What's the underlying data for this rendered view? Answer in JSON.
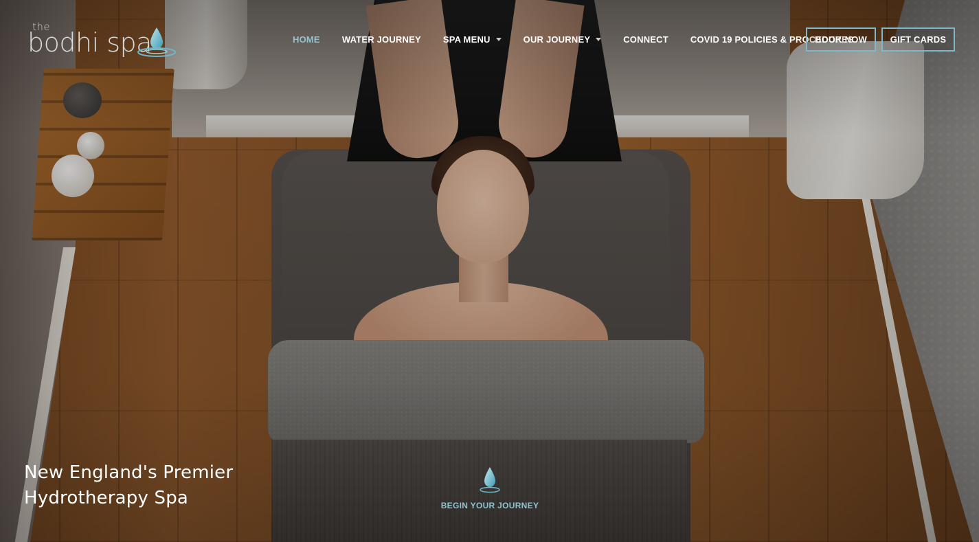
{
  "brand": {
    "logo_the": "the",
    "logo_name": "bodhi spa",
    "accent_color": "#8fc3cf"
  },
  "nav": {
    "items": [
      {
        "label": "HOME",
        "active": true,
        "has_dropdown": false
      },
      {
        "label": "WATER JOURNEY",
        "active": false,
        "has_dropdown": false
      },
      {
        "label": "SPA MENU",
        "active": false,
        "has_dropdown": true
      },
      {
        "label": "OUR JOURNEY",
        "active": false,
        "has_dropdown": true
      },
      {
        "label": "CONNECT",
        "active": false,
        "has_dropdown": false
      },
      {
        "label": "COVID 19 POLICIES & PROCEDURES",
        "active": false,
        "has_dropdown": false
      }
    ],
    "book_now": "BOOK NOW",
    "gift_cards": "GIFT CARDS"
  },
  "hero": {
    "tagline_line1": "New England's Premier",
    "tagline_line2": "Hydrotherapy Spa",
    "cta_label": "BEGIN YOUR JOURNEY",
    "cta_icon": "water-drop-icon"
  }
}
